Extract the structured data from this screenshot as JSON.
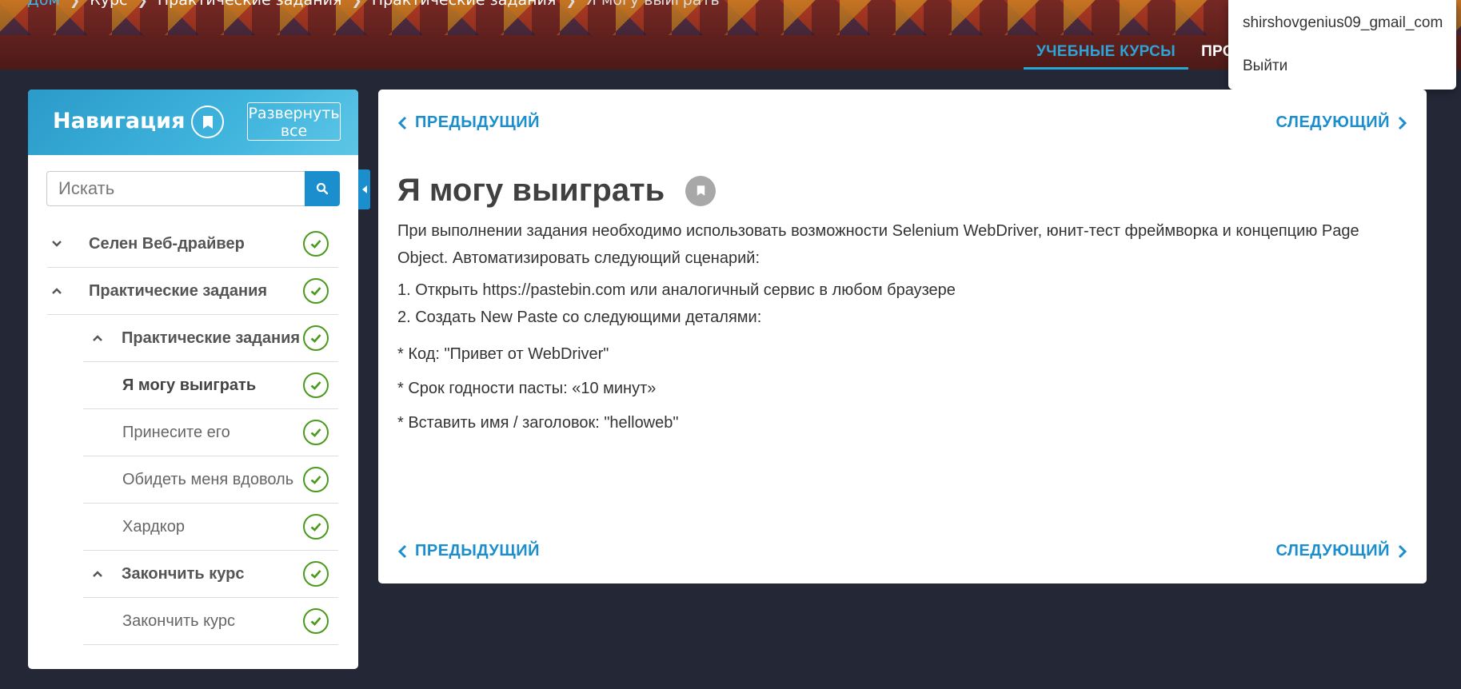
{
  "breadcrumb": {
    "items": [
      "Дом",
      "Курс",
      "Практические задания",
      "Практические задания",
      "Я могу выиграть"
    ]
  },
  "topnav": {
    "tabs": [
      "УЧЕБНЫЕ КУРСЫ",
      "ПРО"
    ]
  },
  "user_menu": {
    "email": "shirshovgenius09_gmail_com",
    "logout": "Выйти"
  },
  "sidebar": {
    "title": "Навигация",
    "expand_label": "Развернуть все",
    "search_placeholder": "Искать",
    "items": [
      {
        "label": "Селен Веб-драйвер",
        "chevron": "chevron-down"
      },
      {
        "label": "Практические задания",
        "chevron": "chevron-up"
      },
      {
        "label": "Практические задания",
        "chevron": "chevron-up"
      },
      {
        "label": "Я могу выиграть"
      },
      {
        "label": "Принесите его"
      },
      {
        "label": "Обидеть меня вдоволь"
      },
      {
        "label": "Хардкор"
      },
      {
        "label": "Закончить курс",
        "chevron": "chevron-up"
      },
      {
        "label": "Закончить курс"
      }
    ]
  },
  "content": {
    "prev_label": "ПРЕДЫДУЩИЙ",
    "next_label": "СЛЕДУЮЩИЙ",
    "title": "Я могу выиграть",
    "intro": "При выполнении задания необходимо использовать возможности Selenium WebDriver, юнит-тест фреймворка и концепцию Page Object. Автоматизировать следующий сценарий:",
    "steps": [
      "1. Открыть https://pastebin.com или аналогичный сервис в любом браузере",
      "2. Создать New Paste со следующими деталями:"
    ],
    "details": [
      "* Код: \"Привет от WebDriver\"",
      "* Срок годности пасты: «10 минут»",
      "* Вставить имя / заголовок: \"helloweb\""
    ]
  },
  "colors": {
    "accent": "#1b8fcd",
    "check": "#4a9a1d",
    "background": "#242736"
  }
}
